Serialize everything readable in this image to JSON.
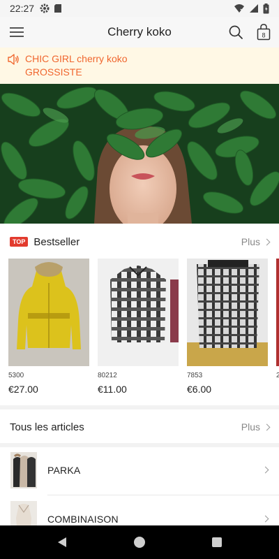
{
  "status_bar": {
    "time": "22:27",
    "icons": [
      "gear-icon",
      "sd-card-icon",
      "wifi-icon",
      "signal-icon",
      "battery-icon"
    ]
  },
  "header": {
    "title": "Cherry koko",
    "cart_count": "8",
    "icons": [
      "menu-icon",
      "search-icon",
      "cart-icon"
    ]
  },
  "notice": {
    "line1": "CHIC GIRL cherry koko",
    "line2": "GROSSISTE",
    "color": "#f0662e",
    "icon": "speaker-icon"
  },
  "bestseller": {
    "badge": "TOP",
    "title": "Bestseller",
    "more": "Plus",
    "products": [
      {
        "code": "5300",
        "price": "€27.00"
      },
      {
        "code": "80212",
        "price": "€11.00"
      },
      {
        "code": "7853",
        "price": "€6.00"
      },
      {
        "code": "2",
        "price": ""
      }
    ]
  },
  "all_articles": {
    "title": "Tous les articles",
    "more": "Plus",
    "categories": [
      {
        "name": "PARKA"
      },
      {
        "name": "COMBINAISON"
      }
    ]
  },
  "colors": {
    "accent": "#f0662e",
    "badge": "#e23b2e",
    "notice_bg": "#fff8e5"
  },
  "nav_bar": {
    "icons": [
      "back-icon",
      "home-icon",
      "recents-icon"
    ]
  }
}
